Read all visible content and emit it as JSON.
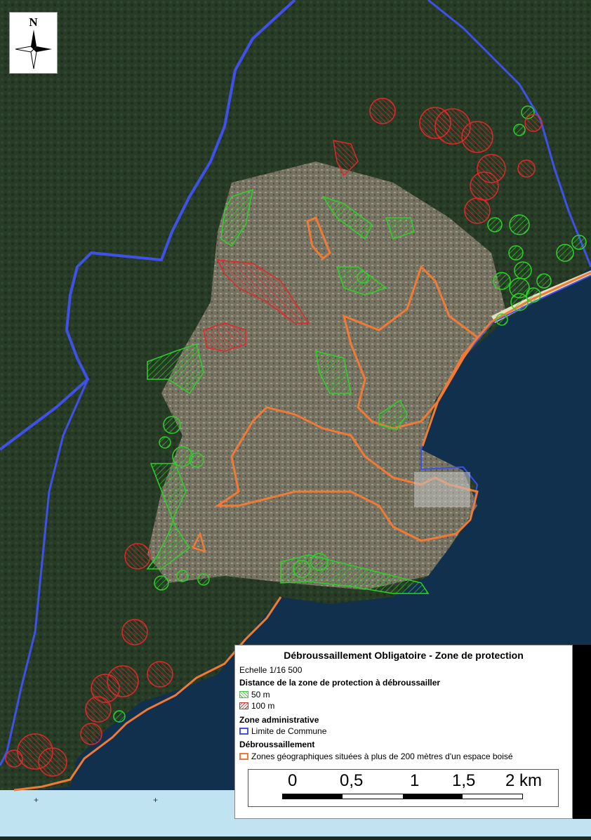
{
  "map": {
    "north_label": "N",
    "colors": {
      "commune_boundary": "#3f51e8",
      "zone_50m": "#2ed12a",
      "zone_100m": "#e0292b",
      "zone_200m": "#f07a36",
      "forest": "#263a25",
      "urban": "#8b8373",
      "sea": "#0f2a44",
      "shallow_sea": "#bfe3f0"
    }
  },
  "legend": {
    "title": "Débroussaillement Obligatoire - Zone de protection",
    "scale_text": "Echelle  1/16 500",
    "section_distance": "Distance de la zone de protection à débroussailler",
    "item_50m": "50 m",
    "item_100m": "100 m",
    "section_admin": "Zone administrative",
    "item_commune": "Limite de Commune",
    "section_debroussaillement": "Débroussaillement",
    "item_zones": "Zones géographiques situées à plus de 200 mètres d'un espace boisé"
  },
  "scale_bar": {
    "labels": [
      "0",
      "0,5",
      "1",
      "1,5",
      "2 km"
    ]
  }
}
